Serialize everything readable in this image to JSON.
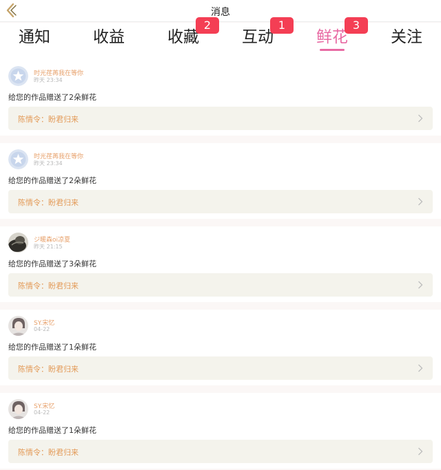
{
  "header": {
    "title": "消息"
  },
  "tabs": [
    {
      "label": "通知",
      "badge": ""
    },
    {
      "label": "收益",
      "badge": ""
    },
    {
      "label": "收藏",
      "badge": "2"
    },
    {
      "label": "互动",
      "badge": "1"
    },
    {
      "label": "鲜花",
      "badge": "3"
    },
    {
      "label": "关注",
      "badge": ""
    }
  ],
  "active_tab": "鲜花",
  "colors": {
    "accent": "#e86aa3",
    "badge": "#f43e54",
    "username": "#e7a06a",
    "work_link": "#e39a57"
  },
  "notifications": [
    {
      "user": "时光荏苒我在等你",
      "time": "昨天 23:34",
      "message": "给您的作品赠送了2朵鲜花",
      "work": "陈情令：盼君归来",
      "avatar": "default-star"
    },
    {
      "user": "时光荏苒我在等你",
      "time": "昨天 23:34",
      "message": "给您的作品赠送了2朵鲜花",
      "work": "陈情令：盼君归来",
      "avatar": "default-star"
    },
    {
      "user": "ジ暖森oi凉夏",
      "time": "昨天 21:15",
      "message": "给您的作品赠送了3朵鲜花",
      "work": "陈情令：盼君归来",
      "avatar": "photo-dark"
    },
    {
      "user": "SY.宋忆",
      "time": "04-22",
      "message": "给您的作品赠送了1朵鲜花",
      "work": "陈情令：盼君归来",
      "avatar": "photo-person"
    },
    {
      "user": "SY.宋忆",
      "time": "04-22",
      "message": "给您的作品赠送了1朵鲜花",
      "work": "陈情令：盼君归来",
      "avatar": "photo-person"
    }
  ]
}
